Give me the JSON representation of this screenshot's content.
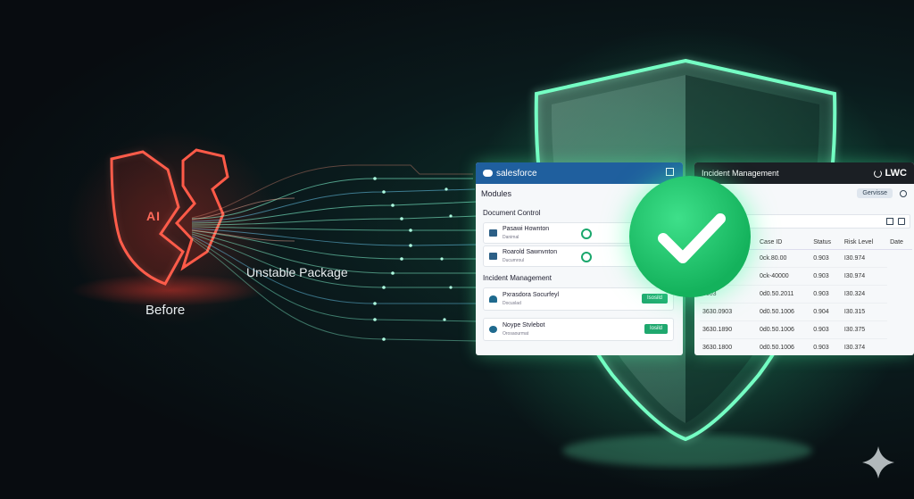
{
  "labels": {
    "before": "Before",
    "unstable": "Unstable Package",
    "ai_mark": "AI"
  },
  "salesforce": {
    "brand": "salesforce",
    "modules": "Modules",
    "doc_section": "Document Control",
    "doc_items": [
      {
        "title": "Pasawi Hownton",
        "sub": "Danimal"
      },
      {
        "title": "Roarold Sawnvnton",
        "sub": "Ducumroul"
      }
    ],
    "inc_section": "Incident Management",
    "inc_items": [
      {
        "title": "Pxrasdora Socurfeyl",
        "sub": "Docuslad",
        "button": "Isosild"
      },
      {
        "title": "Noype Stvlebot",
        "sub": "Orosaourmat",
        "button": "Iosild"
      }
    ]
  },
  "incident_panel": {
    "title": "Incident Management",
    "badge": "LWC",
    "filter": "Gervisse",
    "columns": [
      "Case ID",
      "Status",
      "Risk Level",
      "Date"
    ],
    "rows": [
      [
        "",
        "0ck.80.00",
        "0.903",
        "I30.974"
      ],
      [
        "",
        "0ck-40000",
        "0.903",
        "I30.974"
      ],
      [
        "3003",
        "0d0.50.2011",
        "0.903",
        "I30.324"
      ],
      [
        "3630.0903",
        "0d0.50.1006",
        "0.904",
        "I30.315"
      ],
      [
        "3630.1890",
        "0d0.50.1006",
        "0.903",
        "I30.375"
      ],
      [
        "3630.1800",
        "0d0.50.1006",
        "0.903",
        "I30.374"
      ]
    ]
  },
  "colors": {
    "broken_shield": "#ff4d3d",
    "shield_glow": "#5cffb4",
    "check_bg": "#1fc86a",
    "sf_header": "#1f5f9e"
  }
}
